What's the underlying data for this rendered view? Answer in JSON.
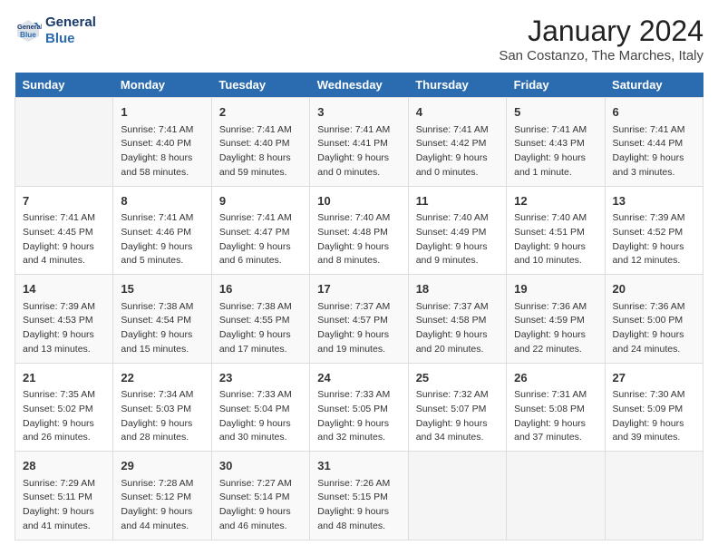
{
  "header": {
    "logo_line1": "General",
    "logo_line2": "Blue",
    "title": "January 2024",
    "subtitle": "San Costanzo, The Marches, Italy"
  },
  "days_of_week": [
    "Sunday",
    "Monday",
    "Tuesday",
    "Wednesday",
    "Thursday",
    "Friday",
    "Saturday"
  ],
  "weeks": [
    [
      {
        "day": "",
        "details": ""
      },
      {
        "day": "1",
        "details": "Sunrise: 7:41 AM\nSunset: 4:40 PM\nDaylight: 8 hours\nand 58 minutes."
      },
      {
        "day": "2",
        "details": "Sunrise: 7:41 AM\nSunset: 4:40 PM\nDaylight: 8 hours\nand 59 minutes."
      },
      {
        "day": "3",
        "details": "Sunrise: 7:41 AM\nSunset: 4:41 PM\nDaylight: 9 hours\nand 0 minutes."
      },
      {
        "day": "4",
        "details": "Sunrise: 7:41 AM\nSunset: 4:42 PM\nDaylight: 9 hours\nand 0 minutes."
      },
      {
        "day": "5",
        "details": "Sunrise: 7:41 AM\nSunset: 4:43 PM\nDaylight: 9 hours\nand 1 minute."
      },
      {
        "day": "6",
        "details": "Sunrise: 7:41 AM\nSunset: 4:44 PM\nDaylight: 9 hours\nand 3 minutes."
      }
    ],
    [
      {
        "day": "7",
        "details": "Sunrise: 7:41 AM\nSunset: 4:45 PM\nDaylight: 9 hours\nand 4 minutes."
      },
      {
        "day": "8",
        "details": "Sunrise: 7:41 AM\nSunset: 4:46 PM\nDaylight: 9 hours\nand 5 minutes."
      },
      {
        "day": "9",
        "details": "Sunrise: 7:41 AM\nSunset: 4:47 PM\nDaylight: 9 hours\nand 6 minutes."
      },
      {
        "day": "10",
        "details": "Sunrise: 7:40 AM\nSunset: 4:48 PM\nDaylight: 9 hours\nand 8 minutes."
      },
      {
        "day": "11",
        "details": "Sunrise: 7:40 AM\nSunset: 4:49 PM\nDaylight: 9 hours\nand 9 minutes."
      },
      {
        "day": "12",
        "details": "Sunrise: 7:40 AM\nSunset: 4:51 PM\nDaylight: 9 hours\nand 10 minutes."
      },
      {
        "day": "13",
        "details": "Sunrise: 7:39 AM\nSunset: 4:52 PM\nDaylight: 9 hours\nand 12 minutes."
      }
    ],
    [
      {
        "day": "14",
        "details": "Sunrise: 7:39 AM\nSunset: 4:53 PM\nDaylight: 9 hours\nand 13 minutes."
      },
      {
        "day": "15",
        "details": "Sunrise: 7:38 AM\nSunset: 4:54 PM\nDaylight: 9 hours\nand 15 minutes."
      },
      {
        "day": "16",
        "details": "Sunrise: 7:38 AM\nSunset: 4:55 PM\nDaylight: 9 hours\nand 17 minutes."
      },
      {
        "day": "17",
        "details": "Sunrise: 7:37 AM\nSunset: 4:57 PM\nDaylight: 9 hours\nand 19 minutes."
      },
      {
        "day": "18",
        "details": "Sunrise: 7:37 AM\nSunset: 4:58 PM\nDaylight: 9 hours\nand 20 minutes."
      },
      {
        "day": "19",
        "details": "Sunrise: 7:36 AM\nSunset: 4:59 PM\nDaylight: 9 hours\nand 22 minutes."
      },
      {
        "day": "20",
        "details": "Sunrise: 7:36 AM\nSunset: 5:00 PM\nDaylight: 9 hours\nand 24 minutes."
      }
    ],
    [
      {
        "day": "21",
        "details": "Sunrise: 7:35 AM\nSunset: 5:02 PM\nDaylight: 9 hours\nand 26 minutes."
      },
      {
        "day": "22",
        "details": "Sunrise: 7:34 AM\nSunset: 5:03 PM\nDaylight: 9 hours\nand 28 minutes."
      },
      {
        "day": "23",
        "details": "Sunrise: 7:33 AM\nSunset: 5:04 PM\nDaylight: 9 hours\nand 30 minutes."
      },
      {
        "day": "24",
        "details": "Sunrise: 7:33 AM\nSunset: 5:05 PM\nDaylight: 9 hours\nand 32 minutes."
      },
      {
        "day": "25",
        "details": "Sunrise: 7:32 AM\nSunset: 5:07 PM\nDaylight: 9 hours\nand 34 minutes."
      },
      {
        "day": "26",
        "details": "Sunrise: 7:31 AM\nSunset: 5:08 PM\nDaylight: 9 hours\nand 37 minutes."
      },
      {
        "day": "27",
        "details": "Sunrise: 7:30 AM\nSunset: 5:09 PM\nDaylight: 9 hours\nand 39 minutes."
      }
    ],
    [
      {
        "day": "28",
        "details": "Sunrise: 7:29 AM\nSunset: 5:11 PM\nDaylight: 9 hours\nand 41 minutes."
      },
      {
        "day": "29",
        "details": "Sunrise: 7:28 AM\nSunset: 5:12 PM\nDaylight: 9 hours\nand 44 minutes."
      },
      {
        "day": "30",
        "details": "Sunrise: 7:27 AM\nSunset: 5:14 PM\nDaylight: 9 hours\nand 46 minutes."
      },
      {
        "day": "31",
        "details": "Sunrise: 7:26 AM\nSunset: 5:15 PM\nDaylight: 9 hours\nand 48 minutes."
      },
      {
        "day": "",
        "details": ""
      },
      {
        "day": "",
        "details": ""
      },
      {
        "day": "",
        "details": ""
      }
    ]
  ]
}
